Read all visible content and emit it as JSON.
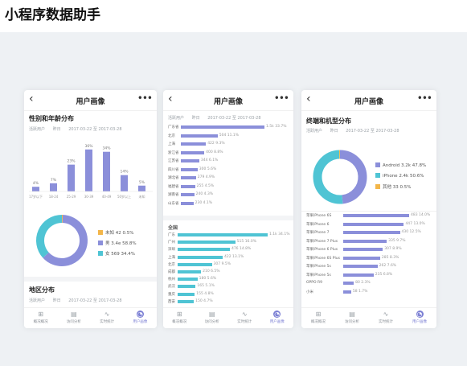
{
  "page_title": "小程序数据助手",
  "colors": {
    "purple": "#8b8fda",
    "teal": "#4fc4d4",
    "orange": "#f3b64a",
    "accent": "#7b7fd4"
  },
  "phones": [
    {
      "nav_title": "用户画像",
      "section_title": "性别和年龄分布",
      "filters": [
        "活跃用户",
        "昨日",
        "2017-03-22 至 2017-03-28"
      ],
      "age_bars": {
        "categories": [
          "17岁以下",
          "18-24",
          "25-29",
          "30-39",
          "40-49",
          "50岁以上",
          "未知"
        ],
        "values": [
          4,
          7,
          23,
          36,
          34,
          14,
          5
        ],
        "labels": [
          "4%",
          "7%",
          "23%",
          "36%",
          "34%",
          "14%",
          "5%"
        ]
      },
      "gender_donut": {
        "legend": [
          "未知 42 0.5%",
          "男 3.4e 58.8%",
          "女 569 34.4%"
        ],
        "values": [
          0.5,
          58.8,
          34.4
        ]
      },
      "section2_title": "地区分布",
      "section2_filters": [
        "活跃用户",
        "昨日",
        "2017-03-22 至 2017-03-28"
      ]
    },
    {
      "nav_title": "用户画像",
      "filters": [
        "活跃用户",
        "昨日",
        "2017-03-22 至 2017-03-28"
      ],
      "list1": {
        "labels": [
          "广东省",
          "北京",
          "上海",
          "浙江省",
          "江苏省",
          "四川省",
          "湖北省",
          "福建省",
          "湖南省",
          "山东省"
        ],
        "values": [
          100,
          44,
          30,
          28,
          22,
          20,
          18,
          17,
          16,
          15
        ],
        "texts": [
          "1.5k 33.7%",
          "504 11.1%",
          "422 9.3%",
          "400 8.8%",
          "344 6.1%",
          "300 5.6%",
          "279 4.9%",
          "255 4.5%",
          "240 4.3%",
          "230 4.1%"
        ]
      },
      "section2_title": "全国",
      "list2": {
        "labels": [
          "广东",
          "广州",
          "深圳",
          "上海",
          "北京",
          "成都",
          "杭州",
          "武汉",
          "重庆",
          "西安"
        ],
        "values": [
          100,
          64,
          58,
          50,
          38,
          26,
          22,
          20,
          19,
          18
        ],
        "texts": [
          "1.1k 34.1%",
          "515 16.0%",
          "476 14.8%",
          "422 13.1%",
          "307 9.5%",
          "210 6.5%",
          "180 5.6%",
          "165 5.1%",
          "155 4.8%",
          "150 4.7%"
        ]
      }
    },
    {
      "nav_title": "用户画像",
      "section_title": "终端和机型分布",
      "filters": [
        "活跃用户",
        "昨日",
        "2017-03-22 至 2017-03-28"
      ],
      "os_donut": {
        "legend": [
          "Android 3.2k 47.8%",
          "iPhone 2.4k 50.6%",
          "其他 33 0.5%"
        ],
        "values": [
          47.8,
          50.6,
          0.5
        ]
      },
      "model_list": {
        "labels": [
          "苹果iPhone 6S",
          "苹果iPhone 6",
          "苹果iPhone 7",
          "苹果iPhone 7 Plus",
          "苹果iPhone 6 Plus",
          "苹果iPhone 6S Plus",
          "苹果iPhone 5s",
          "苹果iPhone 5s",
          "OPPO R9",
          "小米"
        ],
        "values": [
          100,
          92,
          86,
          66,
          60,
          56,
          52,
          46,
          16,
          12
        ],
        "texts": [
          "483 14.0%",
          "447 13.0%",
          "430 12.5%",
          "335 9.7%",
          "307 8.9%",
          "285 8.3%",
          "262 7.6%",
          "235 6.8%",
          "80 2.3%",
          "58 1.7%"
        ]
      }
    }
  ],
  "tabs": [
    "概况概况",
    "访问分析",
    "实时统计",
    "用户画像"
  ]
}
